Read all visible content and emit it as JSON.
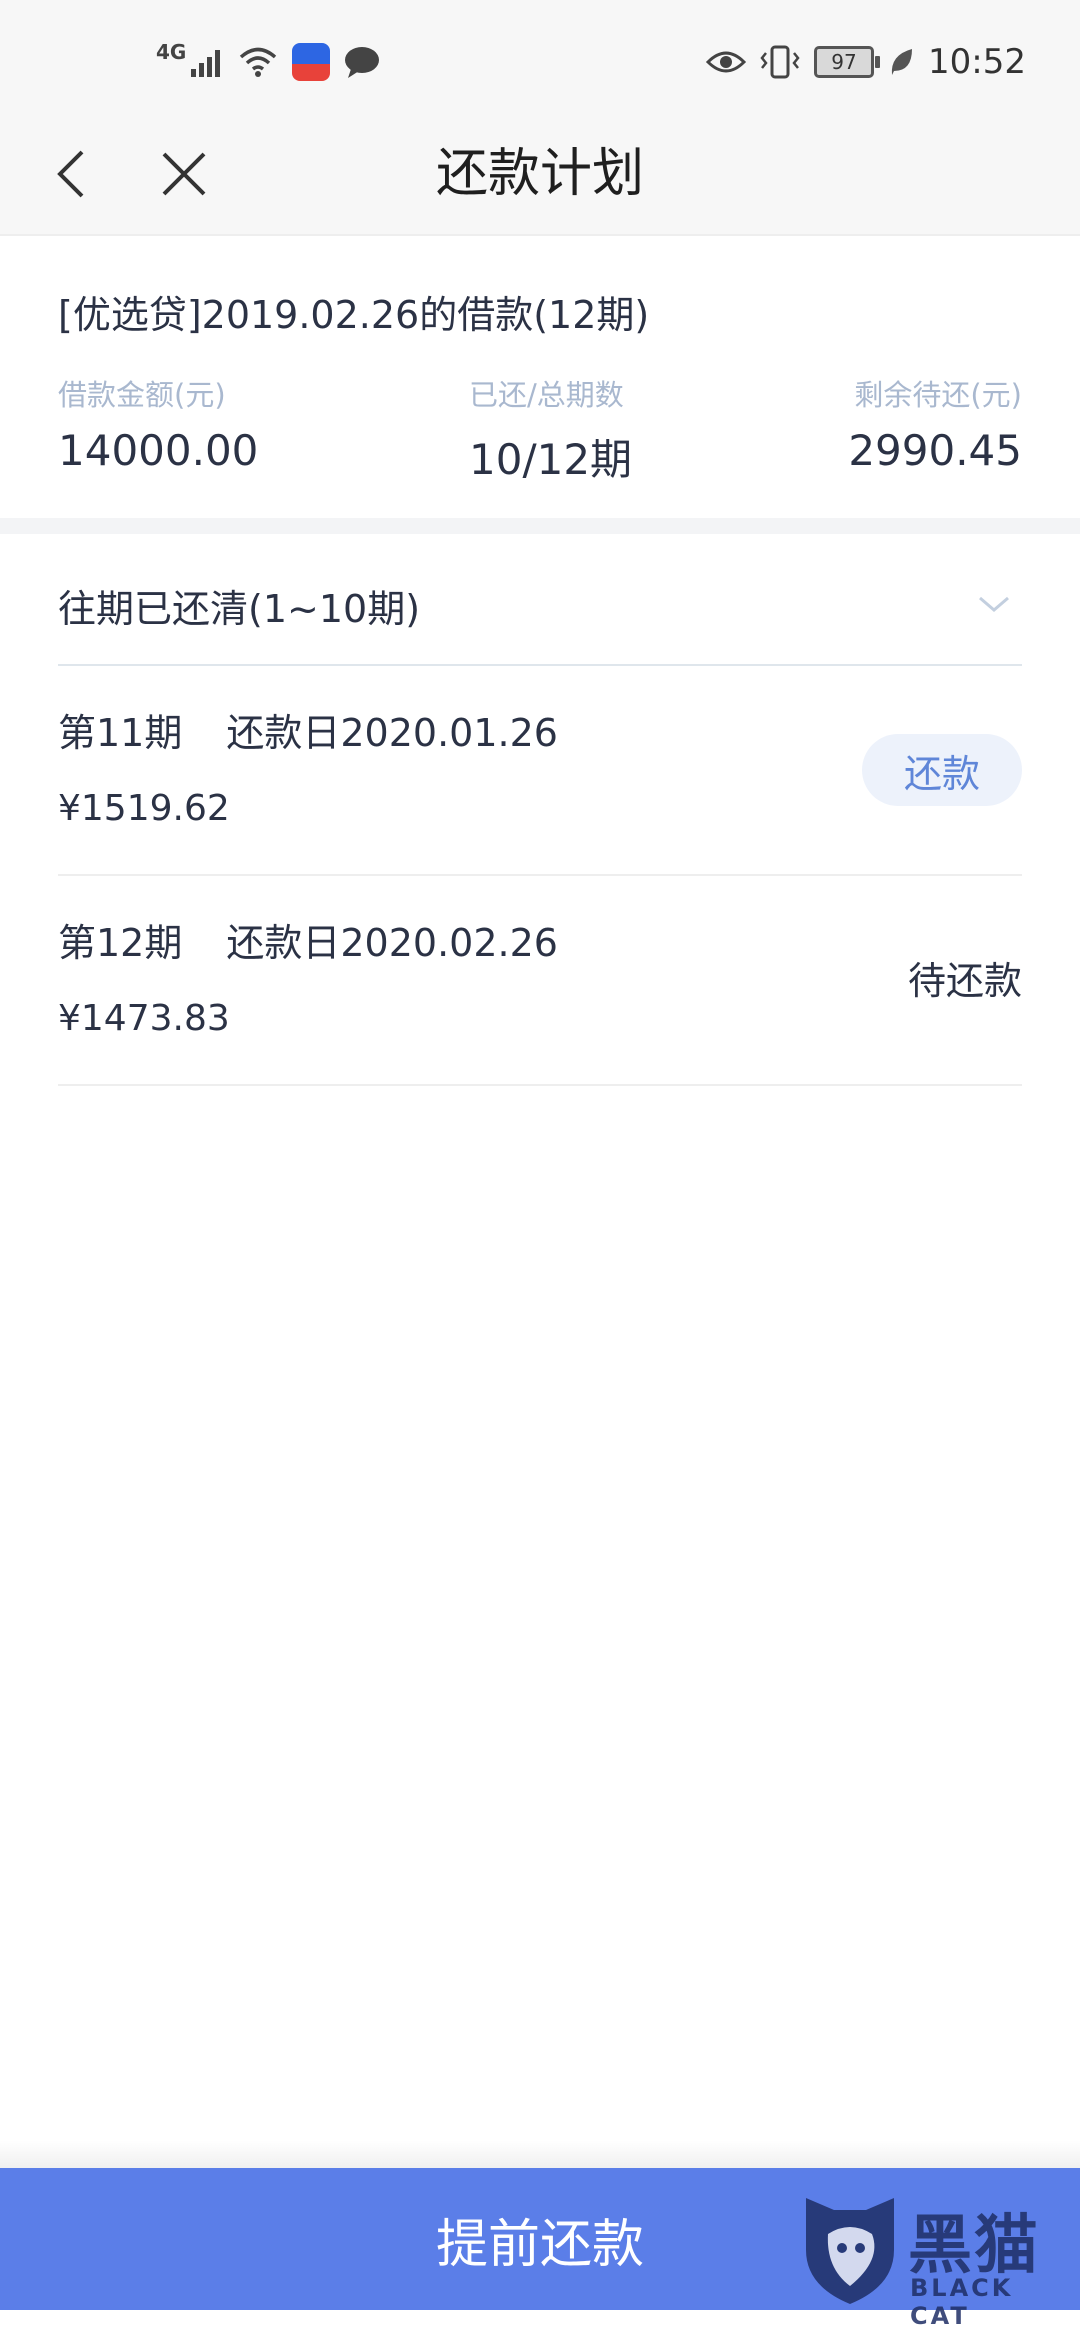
{
  "status_bar": {
    "network": "4G",
    "battery": "97",
    "time": "10:52"
  },
  "nav": {
    "title": "还款计划"
  },
  "loan": {
    "title": "[优选贷]2019.02.26的借款(12期)",
    "stats": [
      {
        "label": "借款金额(元)",
        "value": "14000.00"
      },
      {
        "label": "已还/总期数",
        "value": "10/12期"
      },
      {
        "label": "剩余待还(元)",
        "value": "2990.45"
      }
    ]
  },
  "history": {
    "label": "往期已还清(1~10期)"
  },
  "installments": [
    {
      "period": "第11期",
      "due": "还款日2020.01.26",
      "amount": "¥1519.62",
      "action": "还款"
    },
    {
      "period": "第12期",
      "due": "还款日2020.02.26",
      "amount": "¥1473.83",
      "status": "待还款"
    }
  ],
  "footer": {
    "prepay_label": "提前还款"
  },
  "watermark": {
    "cn": "黑猫",
    "en": "BLACK CAT"
  },
  "colors": {
    "accent": "#5b7ee8",
    "label": "#a9b8cf",
    "text": "#2b3245",
    "repay_button_bg": "#edf2fb",
    "repay_button_text": "#5f86d8"
  }
}
